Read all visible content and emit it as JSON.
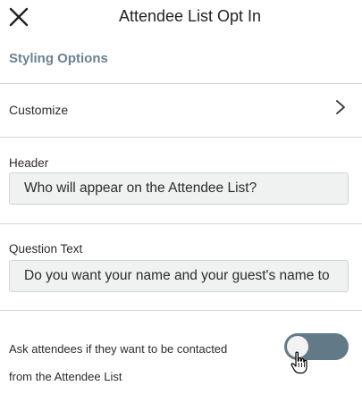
{
  "header": {
    "title": "Attendee List Opt In",
    "close_icon": "close-icon"
  },
  "styling": {
    "section_title": "Styling Options",
    "customize_label": "Customize",
    "customize_icon": "chevron-right-icon"
  },
  "fields": {
    "header_label": "Header",
    "header_value": "Who will appear on the Attendee List?",
    "question_label": "Question Text",
    "question_value": "Do you want your name and your guest's name to be"
  },
  "contact": {
    "label_line1": "Ask attendees if they want to be contacted",
    "label_line2": "from the Attendee List",
    "toggle_state": "off"
  },
  "colors": {
    "section_title": "#6b8191",
    "toggle_track": "#627a87",
    "input_bg": "#f0f2f1",
    "divider": "#d6d6d6"
  }
}
